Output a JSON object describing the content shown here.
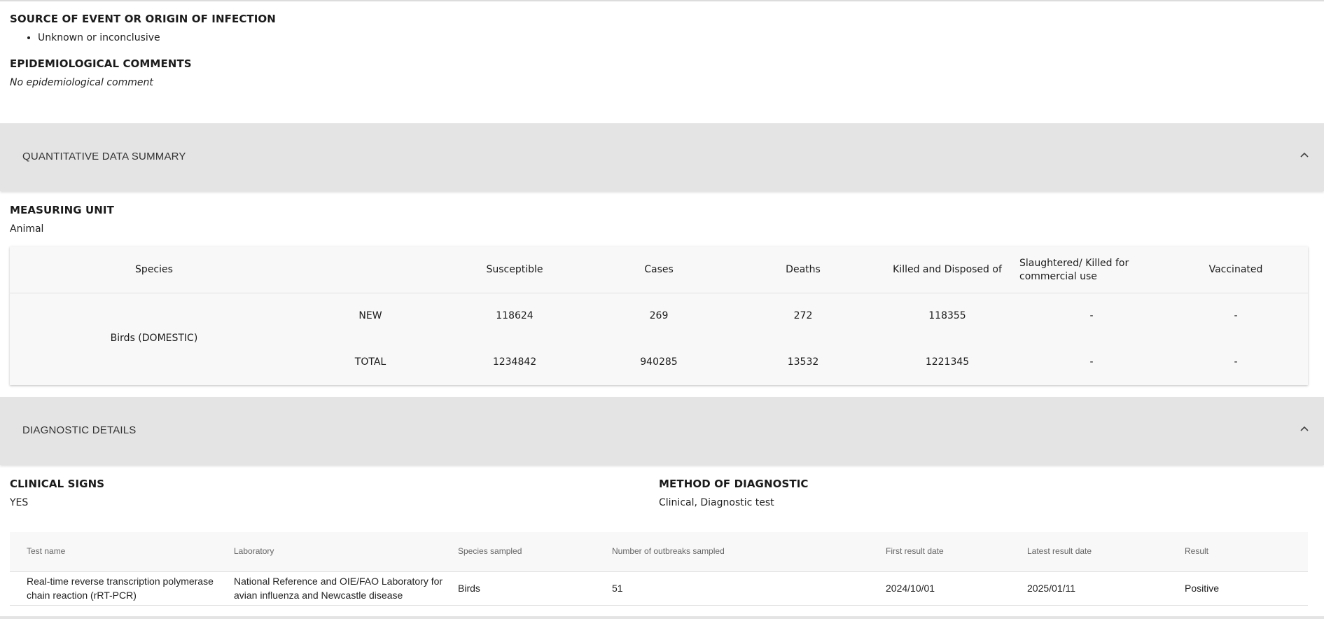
{
  "source": {
    "heading": "SOURCE OF EVENT OR ORIGIN OF INFECTION",
    "items": [
      "Unknown or inconclusive"
    ]
  },
  "epi": {
    "heading": "EPIDEMIOLOGICAL COMMENTS",
    "text": "No epidemiological comment"
  },
  "quantitative": {
    "title": "QUANTITATIVE DATA SUMMARY",
    "chevron_icon": "chevron-up-icon",
    "unit_heading": "MEASURING UNIT",
    "unit_value": "Animal",
    "columns": [
      "Species",
      "Susceptible",
      "Cases",
      "Deaths",
      "Killed and Disposed of",
      "Slaughtered/ Killed for commercial use",
      "Vaccinated"
    ],
    "species": "Birds (DOMESTIC)",
    "rows": [
      {
        "label": "NEW",
        "values": [
          "118624",
          "269",
          "272",
          "118355",
          "-",
          "-"
        ]
      },
      {
        "label": "TOTAL",
        "values": [
          "1234842",
          "940285",
          "13532",
          "1221345",
          "-",
          "-"
        ]
      }
    ]
  },
  "diagnostic": {
    "title": "DIAGNOSTIC DETAILS",
    "chevron_icon": "chevron-up-icon",
    "clinical_heading": "CLINICAL SIGNS",
    "clinical_value": "YES",
    "method_heading": "METHOD OF DIAGNOSTIC",
    "method_value": "Clinical, Diagnostic test",
    "columns": [
      "Test name",
      "Laboratory",
      "Species sampled",
      "Number of outbreaks sampled",
      "First result date",
      "Latest result date",
      "Result"
    ],
    "rows": [
      {
        "test_name": "Real-time reverse transcription polymerase chain reaction (rRT-PCR)",
        "laboratory": "National Reference and OIE/FAO Laboratory for avian influenza and Newcastle disease",
        "species": "Birds",
        "outbreaks": "51",
        "first_date": "2024/10/01",
        "latest_date": "2025/01/11",
        "result": "Positive"
      }
    ]
  }
}
